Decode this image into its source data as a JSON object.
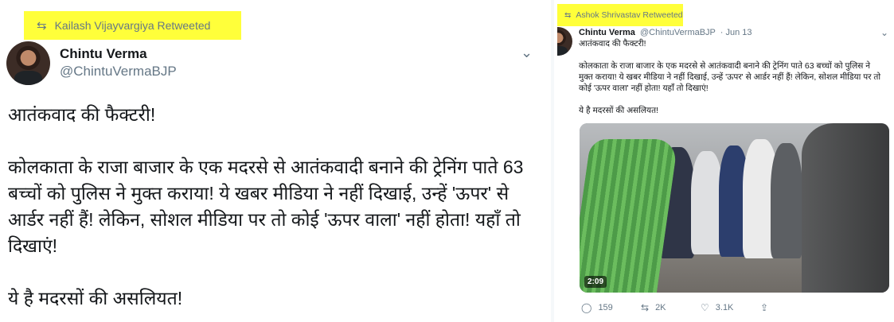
{
  "left_tweet": {
    "retweet_banner": "Kailash Vijayvargiya Retweeted",
    "author_name": "Chintu Verma",
    "author_handle": "@ChintuVermaBJP",
    "paragraphs": [
      "आतंकवाद की फैक्टरी!",
      "कोलकाता के राजा बाजार के एक मदरसे से आतंकवादी बनाने की ट्रेनिंग पाते 63 बच्चों को पुलिस ने मुक्त कराया! ये खबर मीडिया ने नहीं दिखाई, उन्हें 'ऊपर' से आर्डर नहीं हैं! लेकिन, सोशल मीडिया पर तो कोई 'ऊपर वाला' नहीं होता! यहाँ तो दिखाएं!",
      "ये है मदरसों की असलियत!"
    ]
  },
  "right_tweet": {
    "retweet_banner": "Ashok Shrivastav Retweeted",
    "author_name": "Chintu Verma",
    "author_handle": "@ChintuVermaBJP",
    "date": "· Jun 13",
    "paragraphs": [
      "आतंकवाद की फैक्टरी!",
      "कोलकाता के राजा बाजार के एक मदरसे से आतंकवादी बनाने की ट्रेनिंग पाते 63 बच्चों को पुलिस ने मुक्त कराया! ये खबर मीडिया ने नहीं दिखाई, उन्हें 'ऊपर' से आर्डर नहीं हैं! लेकिन, सोशल मीडिया पर तो कोई 'ऊपर वाला' नहीं होता! यहाँ तो दिखाएं!",
      "ये है मदरसों की असलियत!"
    ],
    "video_duration": "2:09",
    "actions": {
      "replies": "159",
      "retweets": "2K",
      "likes": "3.1K"
    }
  },
  "icons": {
    "retweet": "retweet-icon",
    "chevron": "chevron-down-icon",
    "reply": "reply-icon",
    "like": "heart-icon",
    "share": "share-icon"
  },
  "colors": {
    "highlight": "#ffff3a",
    "muted_text": "#657786",
    "primary_text": "#14171a"
  }
}
